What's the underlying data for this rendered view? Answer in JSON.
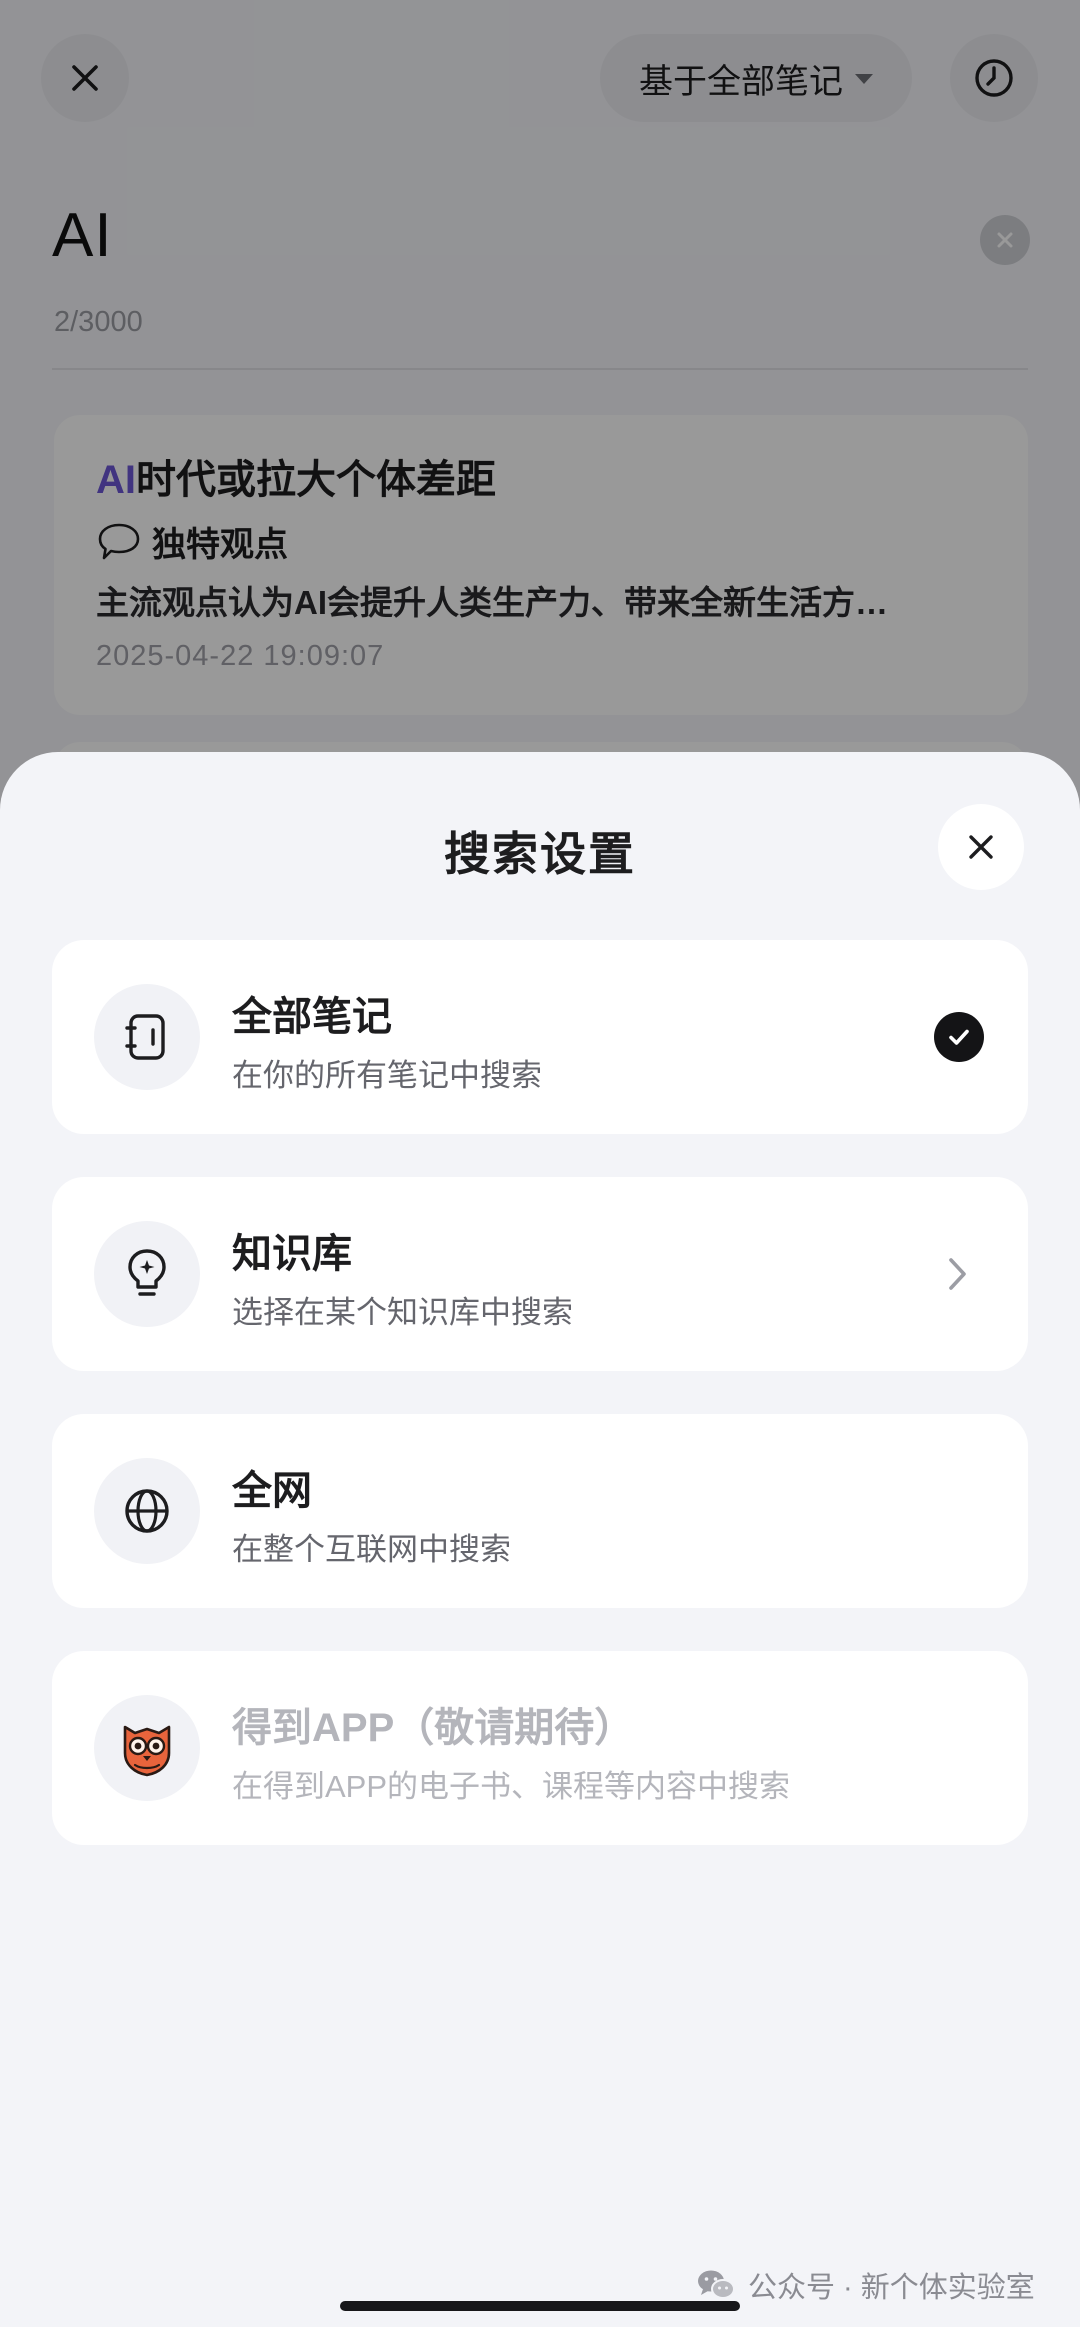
{
  "background_page": {
    "scope_selector_label": "基于全部笔记",
    "query": "AI",
    "char_count": "2/3000",
    "result": {
      "title_highlight": "AI",
      "title_rest": "时代或拉大个体差距",
      "tag_label": "独特观点",
      "snippet": "主流观点认为AI会提升人类生产力、带来全新生活方…",
      "timestamp": "2025-04-22 19:09:07"
    }
  },
  "sheet": {
    "title": "搜索设置",
    "options": [
      {
        "title": "全部笔记",
        "desc": "在你的所有笔记中搜索",
        "icon": "notebook-icon",
        "state": "selected"
      },
      {
        "title": "知识库",
        "desc": "选择在某个知识库中搜索",
        "icon": "lightbulb-icon",
        "state": "navigable"
      },
      {
        "title": "全网",
        "desc": "在整个互联网中搜索",
        "icon": "globe-icon",
        "state": "default"
      },
      {
        "title": "得到APP（敬请期待）",
        "desc": "在得到APP的电子书、课程等内容中搜索",
        "icon": "owl-logo-icon",
        "state": "disabled"
      }
    ]
  },
  "watermark": "公众号 · 新个体实验室",
  "colors": {
    "accent_highlight": "#6d57d6",
    "overlay": "rgba(0,0,0,0.40)",
    "sheet_bg": "#f3f4f8",
    "owl_brand": "#e8643c"
  }
}
